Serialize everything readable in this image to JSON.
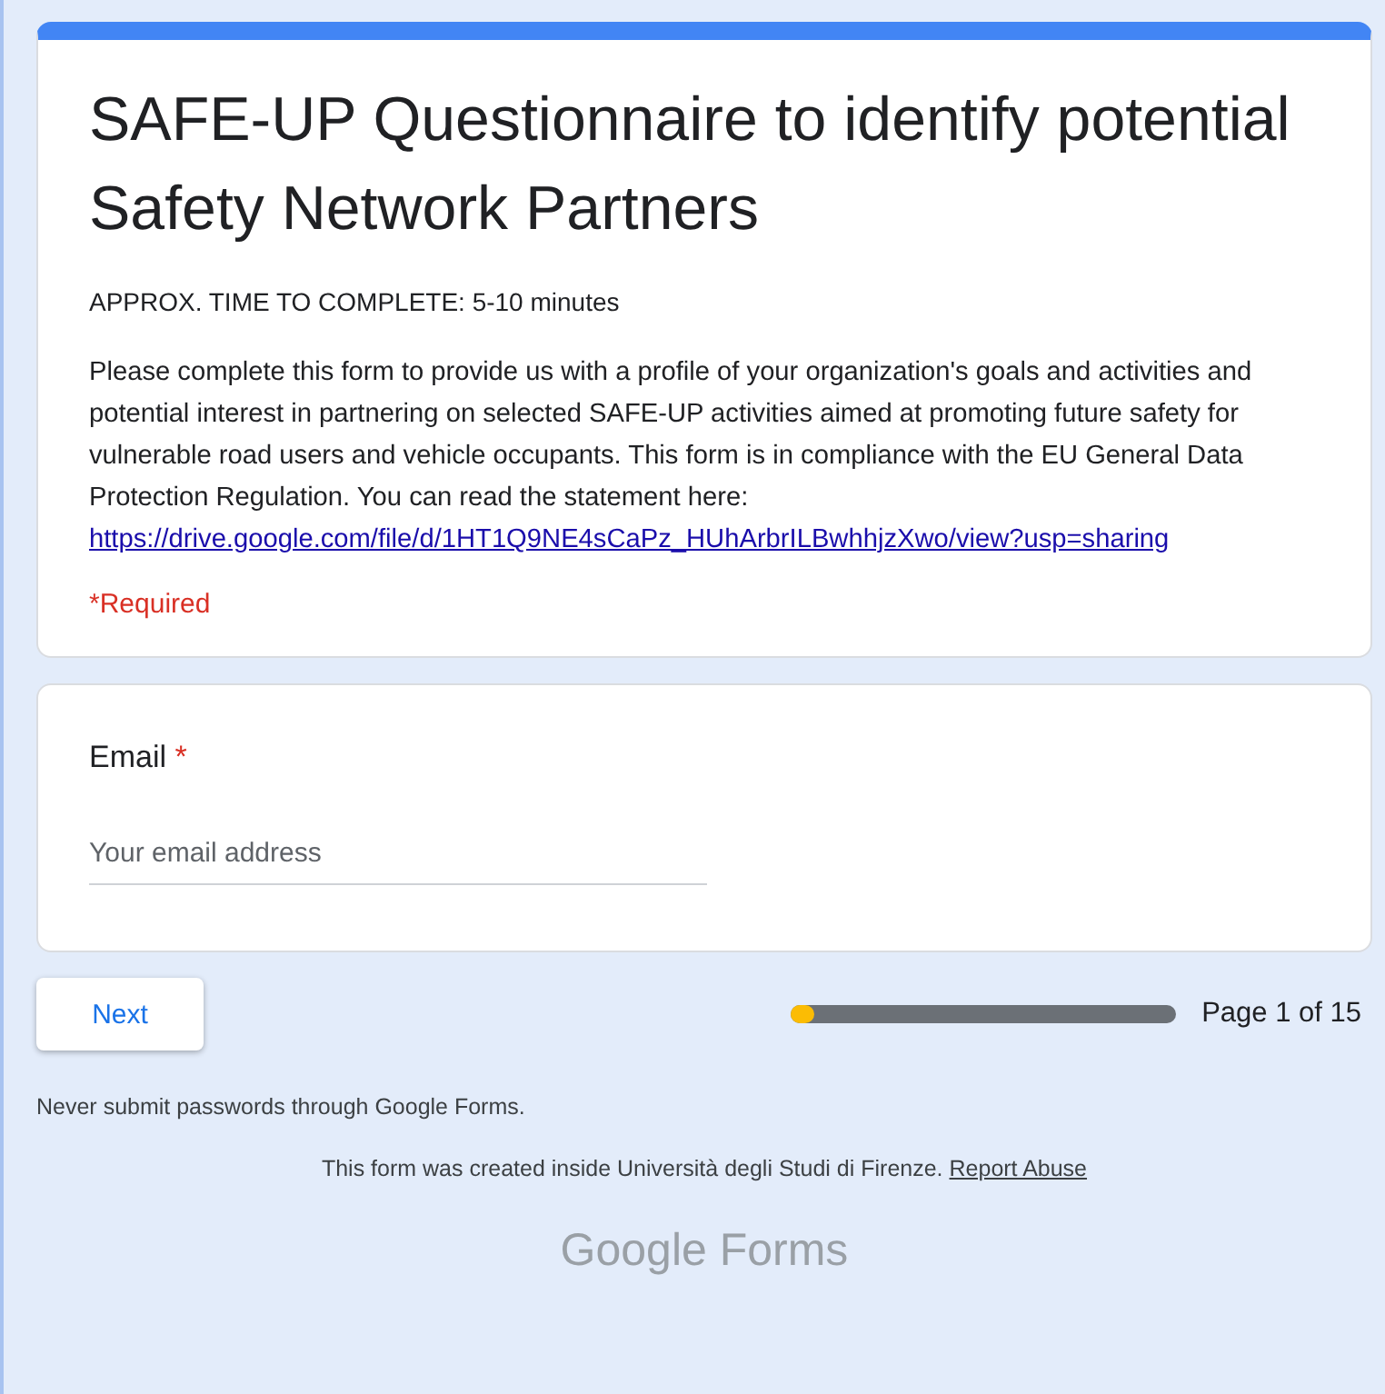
{
  "header": {
    "title": "SAFE-UP Questionnaire to identify potential Safety Network Partners",
    "time_note": "APPROX. TIME TO COMPLETE: 5-10 minutes",
    "description": "Please complete this form to provide us with a profile of your organization's goals and activities and potential interest in partnering on selected SAFE-UP activities aimed at promoting future safety for vulnerable road users and vehicle occupants. This form is in compliance with the EU General Data Protection Regulation. You can read the statement here: ",
    "link": "https://drive.google.com/file/d/1HT1Q9NE4sCaPz_HUhArbrILBwhhjzXwo/view?usp=sharing",
    "required_note": "*Required"
  },
  "question": {
    "label": "Email",
    "required_mark": "*",
    "placeholder": "Your email address"
  },
  "navigation": {
    "next_button": "Next",
    "progress": {
      "level": 0.06,
      "text": "Page 1 of 15"
    }
  },
  "footer": {
    "warning": "Never submit passwords through Google Forms.",
    "created_note": "This form was created inside Università degli Studi di Firenze.",
    "report_link": "Report Abuse",
    "logo": "Google Forms"
  }
}
